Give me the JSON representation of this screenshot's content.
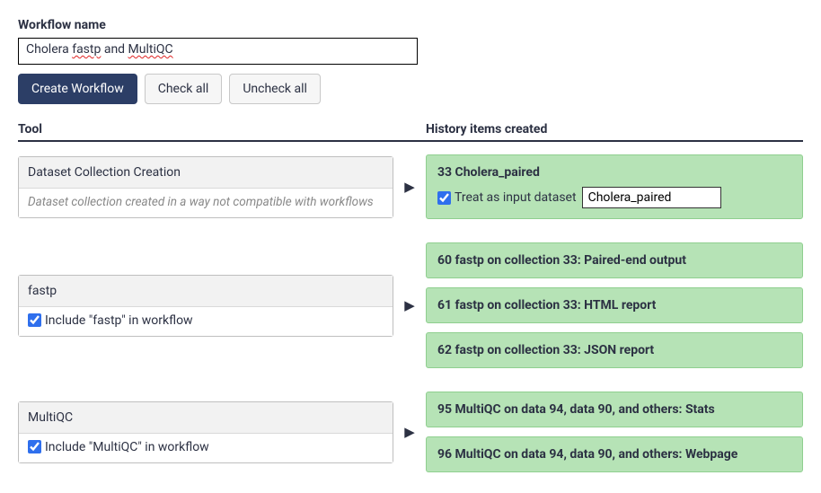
{
  "labels": {
    "workflow_name": "Workflow name",
    "tool_header": "Tool",
    "history_header": "History items created"
  },
  "workflow_name_value": "Cholera fastp and MultiQC",
  "workflow_name_parts": {
    "p1": "Cholera ",
    "p2": "fastp",
    "p3": " and ",
    "p4": "MultiQC"
  },
  "buttons": {
    "create": "Create Workflow",
    "check_all": "Check all",
    "uncheck_all": "Uncheck all"
  },
  "rows": [
    {
      "tool": {
        "title": "Dataset Collection Creation",
        "body_note": "Dataset collection created in a way not compatible with workflows"
      },
      "history": [
        {
          "title": "33 Cholera_paired",
          "treat_label": "Treat as input dataset",
          "treat_checked": true,
          "treat_value": "Cholera_paired"
        }
      ]
    },
    {
      "tool": {
        "title": "fastp",
        "include_label": "Include \"fastp\" in workflow",
        "include_checked": true
      },
      "history": [
        {
          "title": "60 fastp on collection 33: Paired-end output"
        },
        {
          "title": "61 fastp on collection 33: HTML report"
        },
        {
          "title": "62 fastp on collection 33: JSON report"
        }
      ]
    },
    {
      "tool": {
        "title": "MultiQC",
        "include_label": "Include \"MultiQC\" in workflow",
        "include_checked": true
      },
      "history": [
        {
          "title": "95 MultiQC on data 94, data 90, and others: Stats"
        },
        {
          "title": "96 MultiQC on data 94, data 90, and others: Webpage"
        }
      ]
    }
  ]
}
